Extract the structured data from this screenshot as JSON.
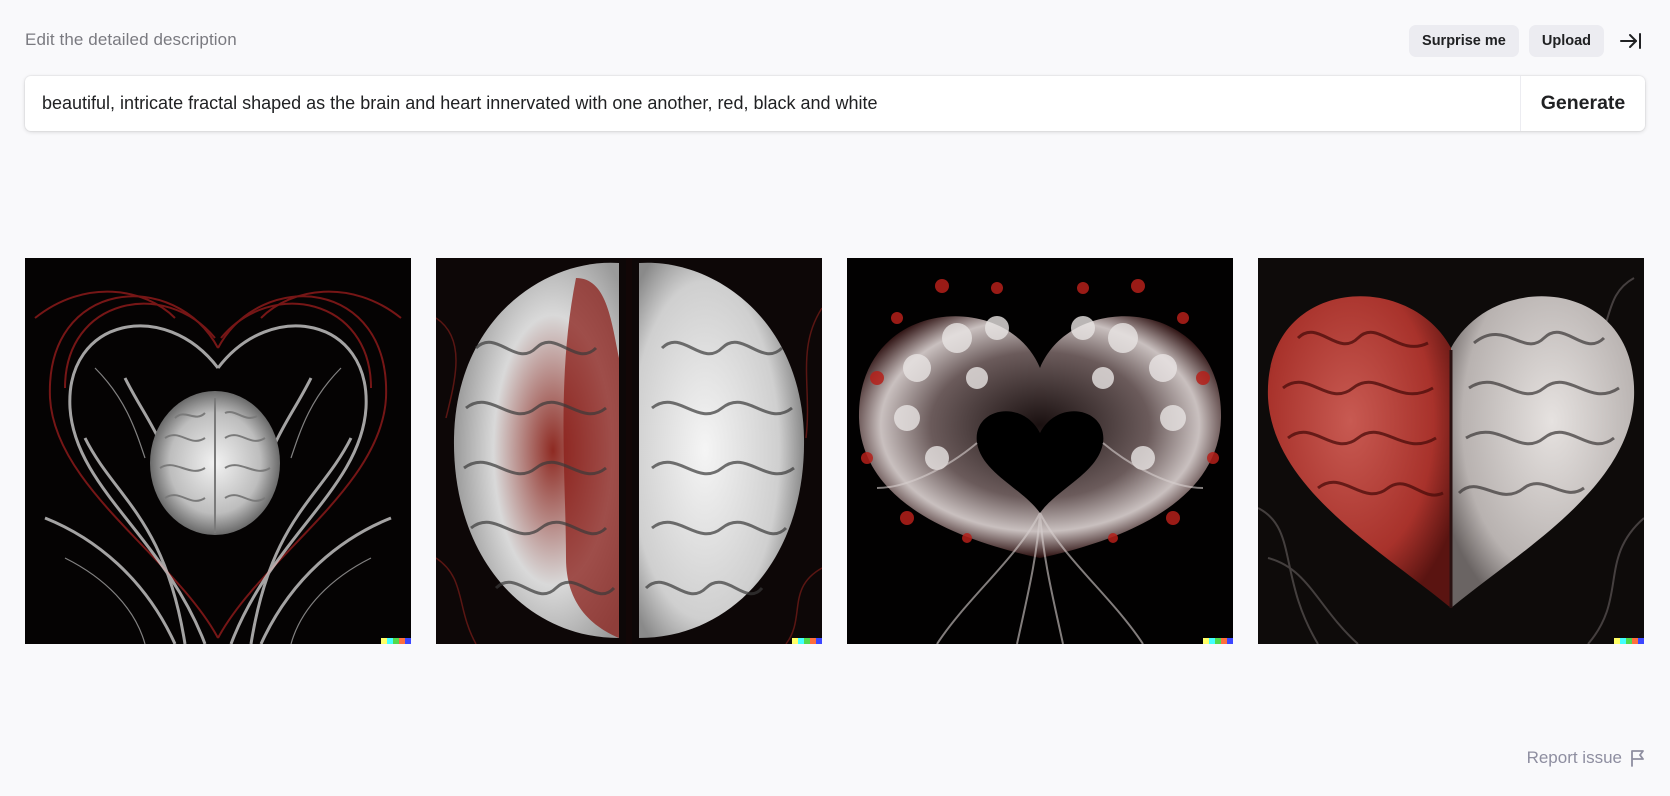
{
  "header": {
    "label": "Edit the detailed description",
    "surprise_label": "Surprise me",
    "upload_label": "Upload",
    "collapse_icon": "arrow-to-right-bar-icon"
  },
  "prompt": {
    "value": "beautiful, intricate fractal shaped as the brain and heart innervated with one another, red, black and white",
    "generate_label": "Generate"
  },
  "gallery": {
    "images": [
      {
        "subject": "heart-of-nerves-with-brain"
      },
      {
        "subject": "brain-half-red-half-white"
      },
      {
        "subject": "fractal-brain-with-heart-center"
      },
      {
        "subject": "heart-shaped-brain-red-and-white"
      }
    ],
    "signature_colors": [
      "#ffff66",
      "#42ffff",
      "#51da4c",
      "#ff6e3c",
      "#3c46ff"
    ]
  },
  "footer": {
    "report_label": "Report issue",
    "report_icon": "flag-icon"
  },
  "colors": {
    "background": "#f9f9fb",
    "button_bg": "#ececf1",
    "text": "#202123",
    "muted": "#7a7a80"
  }
}
